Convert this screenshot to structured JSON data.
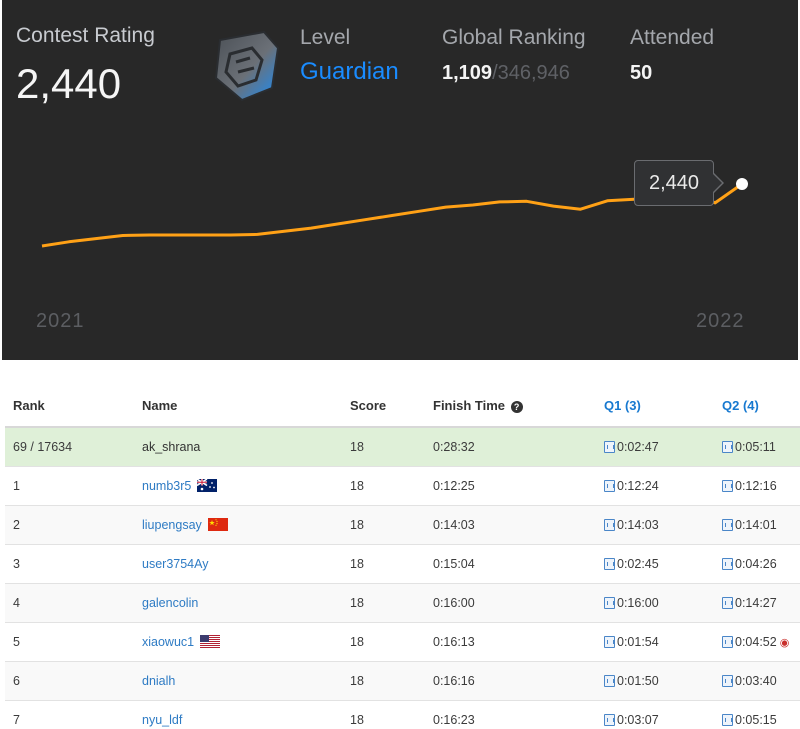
{
  "rating": {
    "contest_rating_label": "Contest Rating",
    "contest_rating_value": "2,440",
    "level_label": "Level",
    "level_value": "Guardian",
    "global_ranking_label": "Global Ranking",
    "global_rank": "1,109",
    "global_total": "/346,946",
    "attended_label": "Attended",
    "attended_value": "50",
    "badge_icon": "guardian-badge-icon",
    "accent_color": "#1a8cff",
    "line_color": "#ffa116"
  },
  "chart_data": {
    "type": "line",
    "x_start_label": "2021",
    "x_end_label": "2022",
    "tooltip_value": "2,440",
    "series": [
      {
        "values": [
          1850,
          1890,
          1920,
          1950,
          1955,
          1955,
          1955,
          1955,
          1960,
          1990,
          2020,
          2060,
          2100,
          2140,
          2180,
          2220,
          2240,
          2270,
          2275,
          2230,
          2200,
          2280,
          2295,
          2250,
          2380,
          2260,
          2440
        ]
      }
    ]
  },
  "table": {
    "headers": [
      "Rank",
      "Name",
      "Score",
      "Finish Time",
      "Q1 (3)",
      "Q2 (4)"
    ],
    "rows": [
      {
        "rank": "69 / 17634",
        "name": "ak_shrana",
        "flag": "",
        "score": "18",
        "finish": "0:28:32",
        "q1": "0:02:47",
        "q2": "0:05:11",
        "bug": false
      },
      {
        "rank": "1",
        "name": "numb3r5",
        "flag": "australia-flag",
        "score": "18",
        "finish": "0:12:25",
        "q1": "0:12:24",
        "q2": "0:12:16",
        "bug": false
      },
      {
        "rank": "2",
        "name": "liupengsay",
        "flag": "china-flag",
        "score": "18",
        "finish": "0:14:03",
        "q1": "0:14:03",
        "q2": "0:14:01",
        "bug": false
      },
      {
        "rank": "3",
        "name": "user3754Ay",
        "flag": "",
        "score": "18",
        "finish": "0:15:04",
        "q1": "0:02:45",
        "q2": "0:04:26",
        "bug": false
      },
      {
        "rank": "4",
        "name": "galencolin",
        "flag": "",
        "score": "18",
        "finish": "0:16:00",
        "q1": "0:16:00",
        "q2": "0:14:27",
        "bug": false
      },
      {
        "rank": "5",
        "name": "xiaowuc1",
        "flag": "usa-flag",
        "score": "18",
        "finish": "0:16:13",
        "q1": "0:01:54",
        "q2": "0:04:52",
        "bug": true
      },
      {
        "rank": "6",
        "name": "dnialh",
        "flag": "",
        "score": "18",
        "finish": "0:16:16",
        "q1": "0:01:50",
        "q2": "0:03:40",
        "bug": false
      },
      {
        "rank": "7",
        "name": "nyu_ldf",
        "flag": "",
        "score": "18",
        "finish": "0:16:23",
        "q1": "0:03:07",
        "q2": "0:05:15",
        "bug": false
      }
    ]
  }
}
